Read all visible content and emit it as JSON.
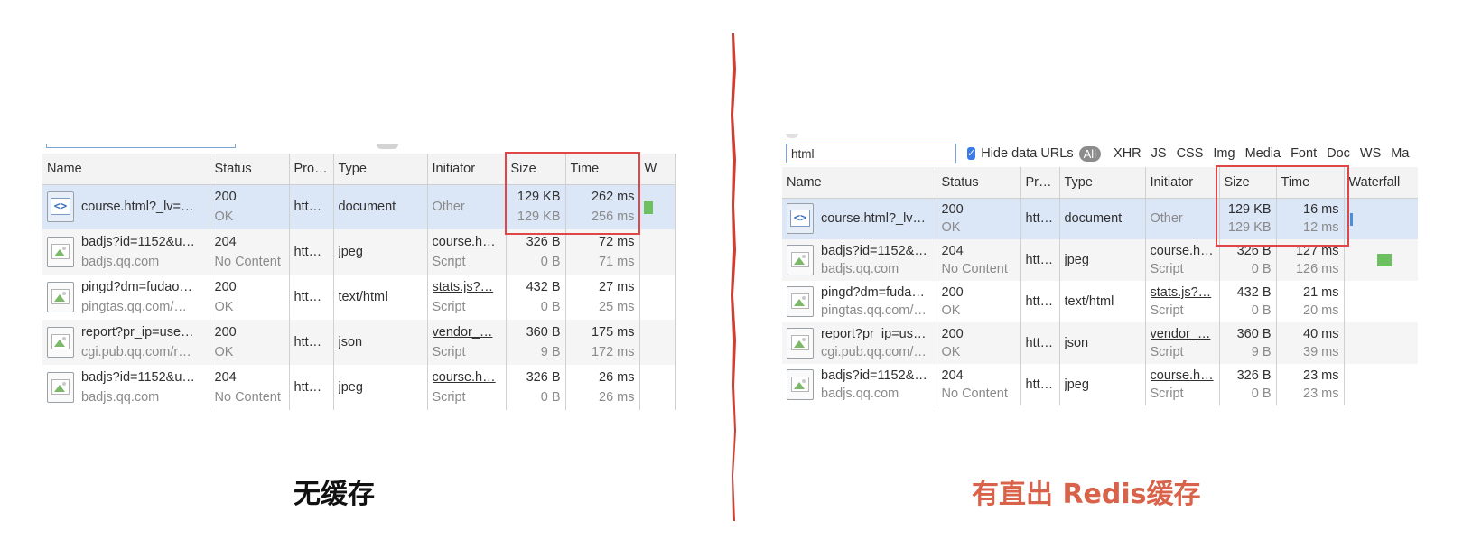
{
  "left": {
    "columns": [
      "Name",
      "Status",
      "Pro…",
      "Type",
      "Initiator",
      "Size",
      "Time",
      "W"
    ],
    "rows": [
      {
        "name": "course.html?_lv=…",
        "domain": "",
        "status": "200",
        "status_text": "OK",
        "protocol": "htt…",
        "type": "document",
        "initiator": "Other",
        "initiator_sub": "",
        "size": "129 KB",
        "size_sub": "129 KB",
        "time": "262 ms",
        "time_sub": "256 ms",
        "icon": "document-icon",
        "selected": true
      },
      {
        "name": "badjs?id=1152&u…",
        "domain": "badjs.qq.com",
        "status": "204",
        "status_text": "No Content",
        "protocol": "htt…",
        "type": "jpeg",
        "initiator": "course.h…",
        "initiator_sub": "Script",
        "size": "326 B",
        "size_sub": "0 B",
        "time": "72 ms",
        "time_sub": "71 ms",
        "icon": "image-icon",
        "selected": false
      },
      {
        "name": "pingd?dm=fudao…",
        "domain": "pingtas.qq.com/…",
        "status": "200",
        "status_text": "OK",
        "protocol": "htt…",
        "type": "text/html",
        "initiator": "stats.js?…",
        "initiator_sub": "Script",
        "size": "432 B",
        "size_sub": "0 B",
        "time": "27 ms",
        "time_sub": "25 ms",
        "icon": "image-icon",
        "selected": false
      },
      {
        "name": "report?pr_ip=use…",
        "domain": "cgi.pub.qq.com/r…",
        "status": "200",
        "status_text": "OK",
        "protocol": "htt…",
        "type": "json",
        "initiator": "vendor_…",
        "initiator_sub": "Script",
        "size": "360 B",
        "size_sub": "9 B",
        "time": "175 ms",
        "time_sub": "172 ms",
        "icon": "image-icon",
        "selected": false
      },
      {
        "name": "badjs?id=1152&u…",
        "domain": "badjs.qq.com",
        "status": "204",
        "status_text": "No Content",
        "protocol": "htt…",
        "type": "jpeg",
        "initiator": "course.h…",
        "initiator_sub": "Script",
        "size": "326 B",
        "size_sub": "0 B",
        "time": "26 ms",
        "time_sub": "26 ms",
        "icon": "image-icon",
        "selected": false
      }
    ],
    "caption": "无缓存"
  },
  "right": {
    "filter": {
      "input_value": "html",
      "hide_data_urls_label": "Hide data URLs",
      "hide_data_urls_checked": true,
      "all_label": "All",
      "types": [
        "XHR",
        "JS",
        "CSS",
        "Img",
        "Media",
        "Font",
        "Doc",
        "WS",
        "Ma"
      ]
    },
    "columns": [
      "Name",
      "Status",
      "Pr…",
      "Type",
      "Initiator",
      "Size",
      "Time",
      "Waterfall"
    ],
    "rows": [
      {
        "name": "course.html?_lv=…",
        "domain": "",
        "status": "200",
        "status_text": "OK",
        "protocol": "htt…",
        "type": "document",
        "initiator": "Other",
        "initiator_sub": "",
        "size": "129 KB",
        "size_sub": "129 KB",
        "time": "16 ms",
        "time_sub": "12 ms",
        "icon": "document-icon",
        "selected": true
      },
      {
        "name": "badjs?id=1152&…",
        "domain": "badjs.qq.com",
        "status": "204",
        "status_text": "No Content",
        "protocol": "htt…",
        "type": "jpeg",
        "initiator": "course.h…",
        "initiator_sub": "Script",
        "size": "326 B",
        "size_sub": "0 B",
        "time": "127 ms",
        "time_sub": "126 ms",
        "icon": "image-icon",
        "selected": false
      },
      {
        "name": "pingd?dm=fuda…",
        "domain": "pingtas.qq.com/…",
        "status": "200",
        "status_text": "OK",
        "protocol": "htt…",
        "type": "text/html",
        "initiator": "stats.js?…",
        "initiator_sub": "Script",
        "size": "432 B",
        "size_sub": "0 B",
        "time": "21 ms",
        "time_sub": "20 ms",
        "icon": "image-icon",
        "selected": false
      },
      {
        "name": "report?pr_ip=use…",
        "domain": "cgi.pub.qq.com/…",
        "status": "200",
        "status_text": "OK",
        "protocol": "htt…",
        "type": "json",
        "initiator": "vendor_…",
        "initiator_sub": "Script",
        "size": "360 B",
        "size_sub": "9 B",
        "time": "40 ms",
        "time_sub": "39 ms",
        "icon": "image-icon",
        "selected": false
      },
      {
        "name": "badjs?id=1152&…",
        "domain": "badjs.qq.com",
        "status": "204",
        "status_text": "No Content",
        "protocol": "htt…",
        "type": "jpeg",
        "initiator": "course.h…",
        "initiator_sub": "Script",
        "size": "326 B",
        "size_sub": "0 B",
        "time": "23 ms",
        "time_sub": "23 ms",
        "icon": "image-icon",
        "selected": false
      }
    ],
    "caption": "有直出 Redis缓存"
  },
  "colors": {
    "highlight_box": "#e04646",
    "divider": "#d63b2f",
    "caption_right": "#d9624a",
    "caption_left": "#111111",
    "selected_row": "#dbe6f6",
    "waterfall_bar": "#6cc05f"
  }
}
